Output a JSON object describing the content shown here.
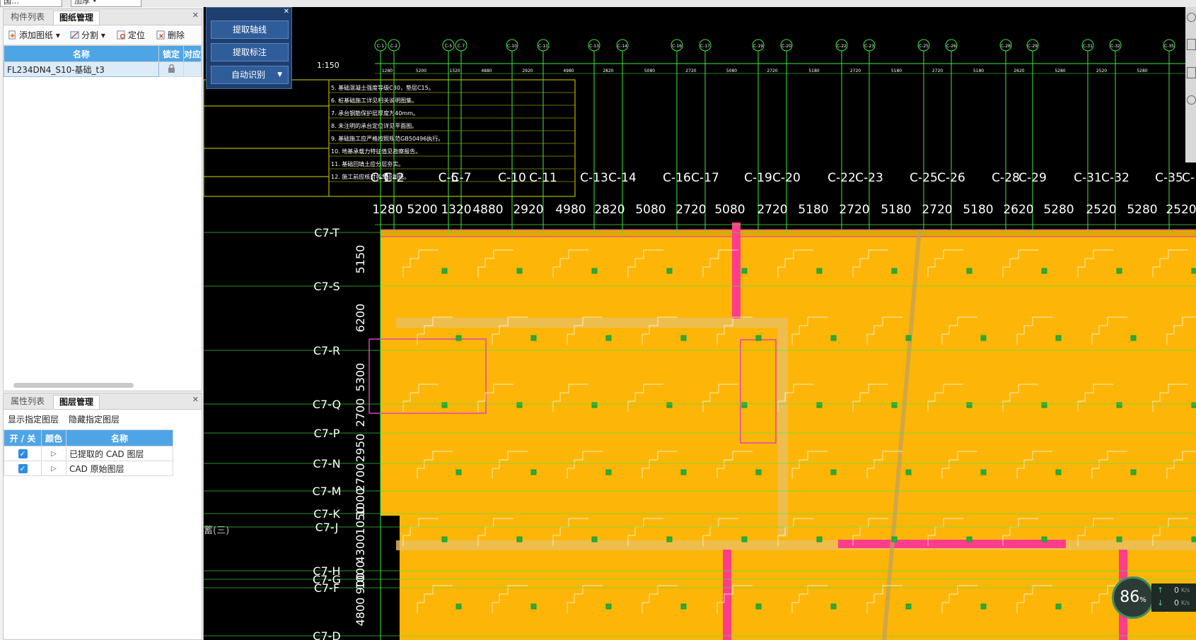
{
  "topbar": {
    "combo1": "国…",
    "combo2": "加厚 •"
  },
  "drawing_panel": {
    "tabs": [
      "构件列表",
      "图纸管理"
    ],
    "active_tab": 1,
    "toolbar": {
      "add": "添加图纸",
      "split": "分割",
      "locate": "定位",
      "delete": "删除"
    },
    "columns": [
      "名称",
      "锁定",
      "对应"
    ],
    "rows": [
      {
        "name": "FL234DN4_S10-基础_t3"
      }
    ]
  },
  "layer_panel": {
    "tabs": [
      "属性列表",
      "图层管理"
    ],
    "active_tab": 1,
    "show_btn": "显示指定图层",
    "hide_btn": "隐藏指定图层",
    "columns": [
      "开 / 关",
      "颜色",
      "名称"
    ],
    "rows": [
      {
        "name": "已提取的 CAD 图层"
      },
      {
        "name": "CAD 原始图层"
      }
    ]
  },
  "float_panel": {
    "btn1": "提取轴线",
    "btn2": "提取标注",
    "btn3": "自动识别"
  },
  "status": {
    "percent": "86",
    "percent_unit": "%",
    "up": "0",
    "down": "0",
    "unit": "K/s"
  },
  "cad": {
    "scale": "1:150",
    "bottom_note": "蓄(三)",
    "axes_top": [
      "C-1",
      "C-2",
      "C-5",
      "C-7",
      "C-10",
      "C-11",
      "C-13",
      "C-14",
      "C-16",
      "C-17",
      "C-19",
      "C-20",
      "C-22",
      "C-23",
      "C-25",
      "C-26",
      "C-28",
      "C-29",
      "C-31",
      "C-32",
      "C-35"
    ],
    "axes_top_small_dims": [
      "1280",
      "5200",
      "1320",
      "4880",
      "2920",
      "4980",
      "2820",
      "5080",
      "2720",
      "5080",
      "2720",
      "5180",
      "2720",
      "5180",
      "2720",
      "5180",
      "2620",
      "5280",
      "2520",
      "5280",
      "2520"
    ],
    "axes_labels_big": [
      "C-1",
      "C-2",
      "C-5",
      "C-7",
      "C-10",
      "C-11",
      "C-13",
      "C-14",
      "C-16",
      "C-17",
      "C-19",
      "C-20",
      "C-22",
      "C-23",
      "C-25",
      "C-26",
      "C-28",
      "C-29",
      "C-31",
      "C-32",
      "C-35",
      "C-"
    ],
    "dims_big": [
      "1280",
      "5200",
      "1320",
      "4880",
      "2920",
      "4980",
      "2820",
      "5080",
      "2720",
      "5080",
      "2720",
      "5180",
      "2720",
      "5180",
      "2720",
      "5180",
      "2620",
      "5280",
      "2520",
      "5280",
      "2520"
    ],
    "axes_left": [
      "C7-T",
      "C7-S",
      "C7-R",
      "C7-Q",
      "C7-P",
      "C7-N",
      "C7-M",
      "C7-K",
      "C7-J",
      "C7-H",
      "C7-G",
      "C7-F",
      "C7-D"
    ],
    "dims_left": [
      "5150",
      "6200",
      "5300",
      "2700",
      "2950",
      "2700",
      "1000",
      "1050",
      "4300",
      "1000",
      "900",
      "4800"
    ],
    "notes": [
      "5. 基础混凝土强度等级C30，垫层C15。",
      "6. 桩基础施工详见相关说明图集。",
      "7. 承台钢筋保护层厚度为40mm。",
      "8. 未注明的承台定位详见平面图。",
      "9. 基础施工应严格按照规范GB50496执行。",
      "10. 地基承载力特征值见勘察报告。",
      "11. 基础回填土应分层夯实。",
      "12. 施工前应核对各专业图纸。"
    ]
  }
}
